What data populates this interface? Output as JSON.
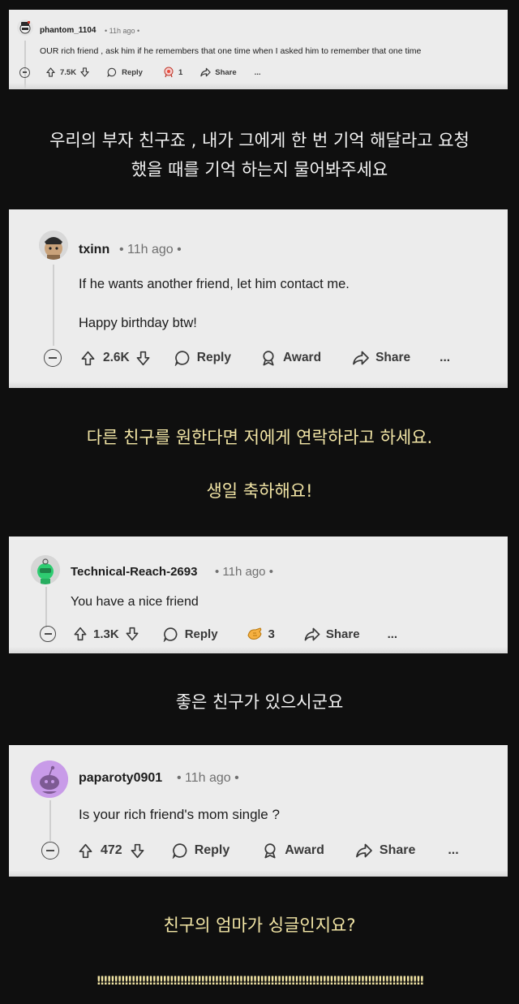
{
  "comments": [
    {
      "username": "phantom_1104",
      "time": "• 11h ago •",
      "lines": [
        "OUR rich friend , ask him if he remembers that one time when I asked him to remember that one time"
      ],
      "upvotes": "7.5K",
      "reply_label": "Reply",
      "award_count": "1",
      "share_label": "Share",
      "more_label": "..."
    },
    {
      "username": "txinn",
      "time": "• 11h ago •",
      "lines": [
        "If he wants another friend, let him contact me.",
        "Happy birthday btw!"
      ],
      "upvotes": "2.6K",
      "reply_label": "Reply",
      "award_label": "Award",
      "share_label": "Share",
      "more_label": "..."
    },
    {
      "username": "Technical-Reach-2693",
      "time": "• 11h ago •",
      "lines": [
        "You have a nice friend"
      ],
      "upvotes": "1.3K",
      "reply_label": "Reply",
      "award_count": "3",
      "share_label": "Share",
      "more_label": "..."
    },
    {
      "username": "paparoty0901",
      "time": "• 11h ago •",
      "lines": [
        "Is your rich friend's mom single ?"
      ],
      "upvotes": "472",
      "reply_label": "Reply",
      "award_label": "Award",
      "share_label": "Share",
      "more_label": "..."
    }
  ],
  "captions": [
    {
      "lines": [
        "우리의 부자 친구죠 , 내가 그에게 한 번 기억 해달라고 요청",
        "했을 때를 기억 하는지 물어봐주세요"
      ],
      "color": "#f2f2f2"
    },
    {
      "lines": [
        "다른 친구를 원한다면 저에게 연락하라고 하세요.",
        "생일 축하해요!"
      ],
      "color": "#f3e6a6"
    },
    {
      "lines": [
        "좋은 친구가 있으시군요"
      ],
      "color": "#f2f2f2"
    },
    {
      "lines": [
        "친구의 엄마가 싱글인지요?"
      ],
      "color": "#f3e6a6"
    }
  ],
  "exclaim": "!!!!!!!!!!!!!!!!!!!!!!!!!!!!!!!!!!!!!!!!!!!!!!!!!!!!!!!!!!!!!!!!!!!!!!!!!!!!!!!!!!!!!!!!!!!!!!",
  "icons": {
    "collapse": "minus-circle-icon",
    "upvote": "arrow-up-icon",
    "downvote": "arrow-down-icon",
    "reply": "speech-bubble-icon",
    "award": "award-ribbon-icon",
    "share": "share-arrow-icon"
  },
  "colors": {
    "background": "#0f0f0f",
    "card": "#ececec",
    "caption_white": "#f2f2f2",
    "caption_yellow": "#f3e6a6",
    "avatar_purple": "#c89be8"
  }
}
